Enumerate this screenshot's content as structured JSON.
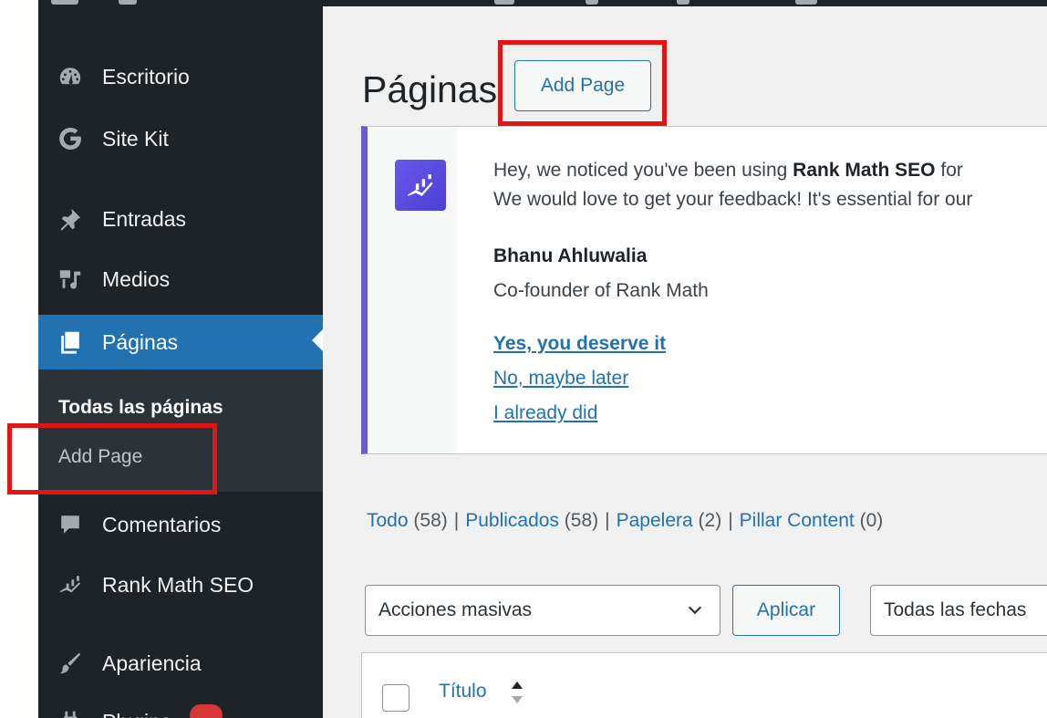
{
  "colors": {
    "sidebar_bg": "#1d2327",
    "active_bg": "#2271b1",
    "link": "#2271b1",
    "highlight": "#e01515",
    "notice_accent": "#6a5acd"
  },
  "sidebar": {
    "items": [
      {
        "label": "Escritorio",
        "icon": "dashboard-icon"
      },
      {
        "label": "Site Kit",
        "icon": "google-g-icon"
      },
      {
        "label": "Entradas",
        "icon": "pushpin-icon"
      },
      {
        "label": "Medios",
        "icon": "media-icon"
      },
      {
        "label": "Páginas",
        "icon": "pages-icon",
        "active": true
      },
      {
        "label": "Comentarios",
        "icon": "comment-icon"
      },
      {
        "label": "Rank Math SEO",
        "icon": "rank-math-icon"
      },
      {
        "label": "Apariencia",
        "icon": "brush-icon"
      },
      {
        "label": "Plugins",
        "icon": "plug-icon"
      }
    ],
    "submenu": [
      {
        "label": "Todas las páginas",
        "current": true
      },
      {
        "label": "Add Page"
      }
    ]
  },
  "header": {
    "title": "Páginas",
    "add_button": "Add Page"
  },
  "notice": {
    "line1_prefix": "Hey, we noticed you've been using ",
    "line1_bold": "Rank Math SEO",
    "line1_suffix": " for",
    "line2": "We would love to get your feedback! It's essential for our",
    "author": "Bhanu Ahluwalia",
    "role": "Co-founder of Rank Math",
    "link_yes": "Yes, you deserve it",
    "link_later": "No, maybe later",
    "link_did": "I already did"
  },
  "views": [
    {
      "label": "Todo",
      "count": "(58)"
    },
    {
      "label": "Publicados",
      "count": "(58)"
    },
    {
      "label": "Papelera",
      "count": "(2)"
    },
    {
      "label": "Pillar Content",
      "count": "(0)"
    }
  ],
  "views_separator": "|",
  "bulk": {
    "selected": "Acciones masivas",
    "apply": "Aplicar",
    "dates": "Todas las fechas"
  },
  "table": {
    "col_title": "Título"
  }
}
